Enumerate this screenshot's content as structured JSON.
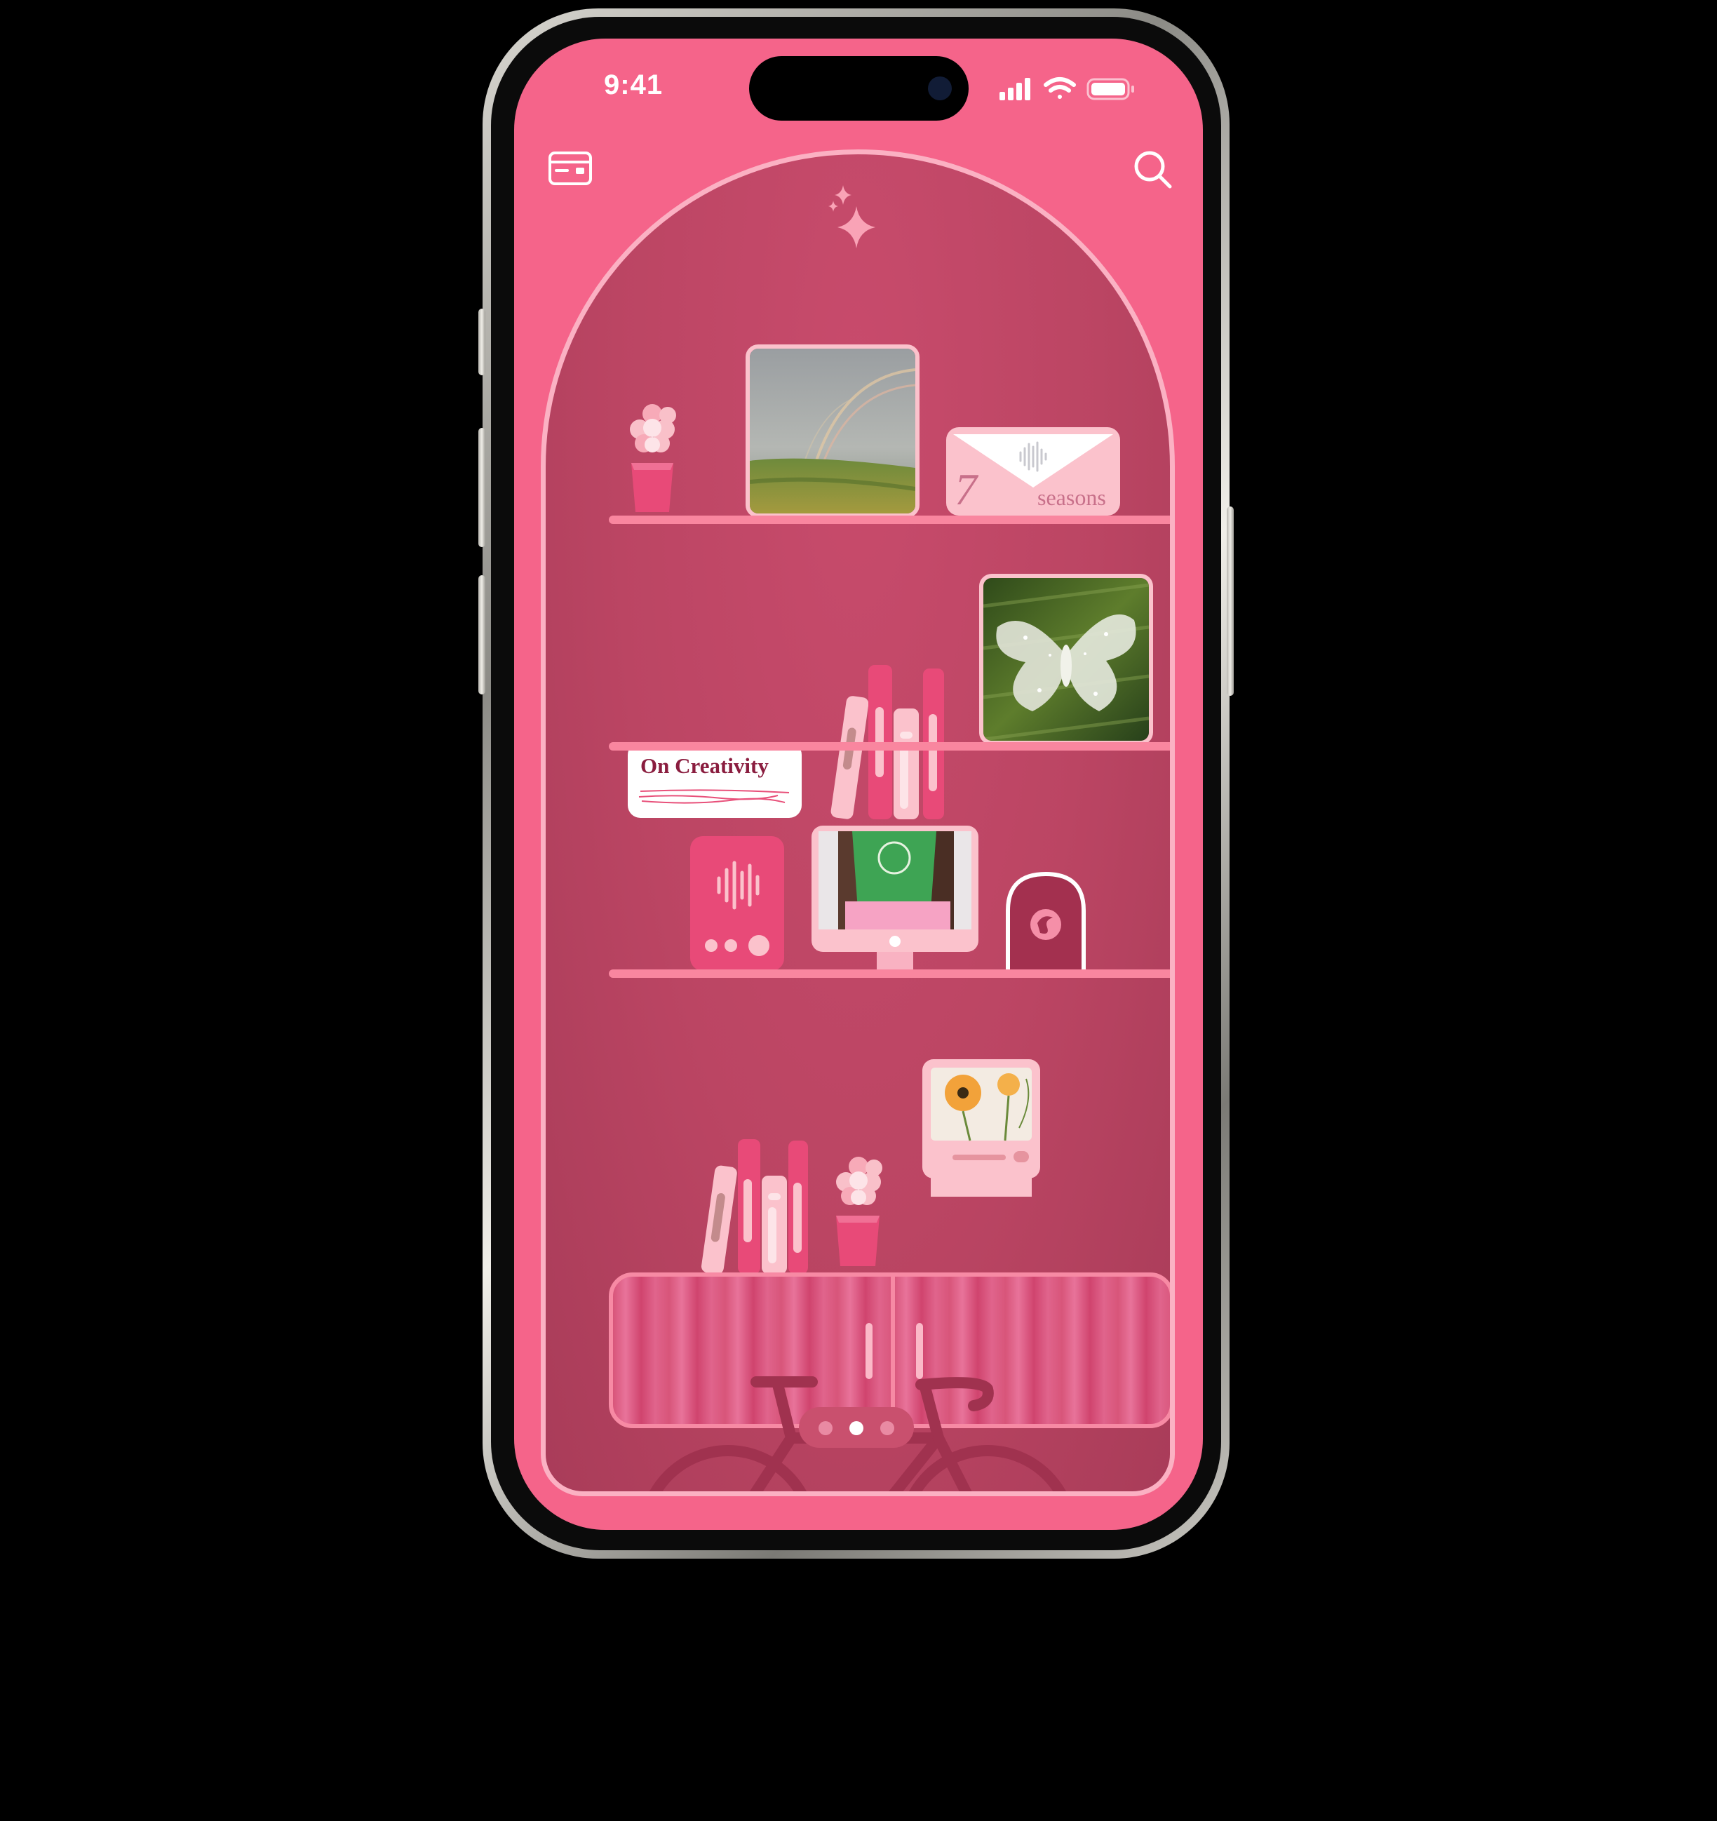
{
  "status_bar": {
    "time": "9:41",
    "signal_icon": "cellular-signal-icon",
    "wifi_icon": "wifi-icon",
    "battery_icon": "battery-icon"
  },
  "header": {
    "left_icon": "card-icon",
    "right_icon": "search-icon"
  },
  "shelves": {
    "shelf_1": {
      "items": [
        "flower-vase",
        "rainbow-photo",
        "audio-envelope"
      ],
      "envelope_number": "7",
      "envelope_label": "seasons"
    },
    "shelf_2": {
      "items": [
        "note-card",
        "books",
        "moth-photo"
      ],
      "note_title": "On Creativity"
    },
    "shelf_3": {
      "items": [
        "audio-device",
        "computer-photo",
        "arch-lamp"
      ]
    },
    "shelf_4": {
      "items": [
        "books",
        "flower-vase",
        "retro-computer-photo",
        "cabinet"
      ]
    }
  },
  "decoration": {
    "sparkle_icon": "sparkle-icon",
    "bicycle_icon": "bicycle-icon"
  },
  "pagination": {
    "page_count": 3,
    "current_page": 2
  },
  "colors": {
    "background": "#f5648a",
    "arch": "#bb4563",
    "arch_border": "#fbb1c3",
    "shelf": "#f9869f",
    "accent_dark": "#8a1d3f"
  }
}
